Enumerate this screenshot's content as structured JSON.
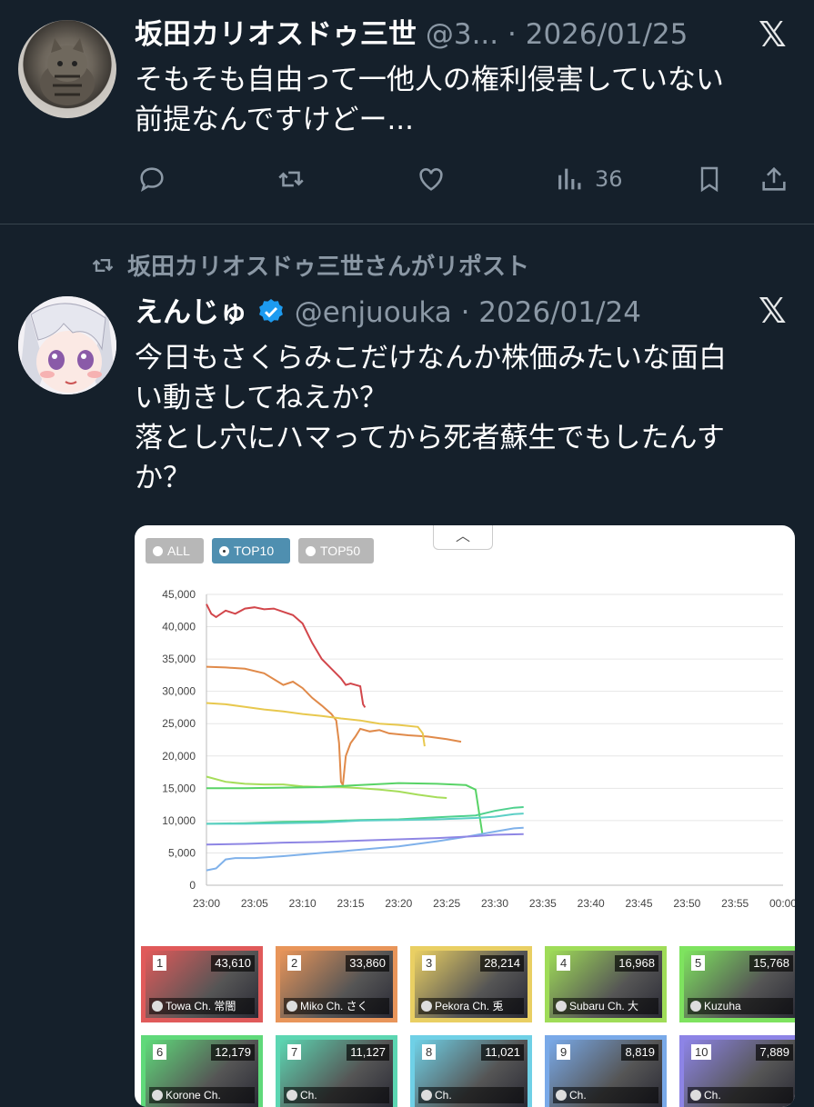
{
  "tweet1": {
    "display_name": "坂田カリオスドゥ三世",
    "handle": "@3...",
    "date": "· 2026/01/25",
    "text_lines": [
      "そもそも自由って一他人の権利侵害していない",
      "前提なんですけどー..."
    ],
    "views": "36",
    "icons": [
      "reply-icon",
      "repost-icon",
      "like-icon",
      "views-icon",
      "bookmark-icon",
      "share-icon",
      "x-logo-icon"
    ]
  },
  "tweet2": {
    "repost_label": "坂田カリオスドゥ三世さんがリポスト",
    "display_name": "えんじゅ",
    "handle": "@enjuouka",
    "date": "· 2026/01/24",
    "text_lines": [
      "今日もさくらみこだけなんか株価みたいな面白",
      "い動きしてねえか？",
      "落とし穴にハマってから死者蘇生でもしたんす",
      "か？"
    ],
    "verified_icon": "verified-badge-icon"
  },
  "embedded": {
    "tabs": [
      "ALL",
      "TOP10",
      "TOP50"
    ],
    "selected_tab": "TOP10",
    "collapse_icon": "chevron-up-icon",
    "tiles": [
      {
        "rank": "1",
        "count": "43,610",
        "channel": "Towa Ch. 常闇",
        "color": "#e05a5a"
      },
      {
        "rank": "2",
        "count": "33,860",
        "channel": "Miko Ch. さく",
        "color": "#e8955a"
      },
      {
        "rank": "3",
        "count": "28,214",
        "channel": "Pekora Ch. 兎",
        "color": "#e9cf63"
      },
      {
        "rank": "4",
        "count": "16,968",
        "channel": "Subaru Ch. 大",
        "color": "#9fdc58"
      },
      {
        "rank": "5",
        "count": "15,768",
        "channel": "Kuzuha",
        "color": "#7ee35f"
      },
      {
        "rank": "6",
        "count": "12,179",
        "channel": "Korone Ch.",
        "color": "#5fd97a"
      },
      {
        "rank": "7",
        "count": "11,127",
        "channel": "Ch.",
        "color": "#5cd6b2"
      },
      {
        "rank": "8",
        "count": "11,021",
        "channel": "Ch.",
        "color": "#6fd0e6"
      },
      {
        "rank": "9",
        "count": "8,819",
        "channel": "Ch.",
        "color": "#79a9e8"
      },
      {
        "rank": "10",
        "count": "7,889",
        "channel": "Ch.",
        "color": "#8d84e6"
      }
    ]
  },
  "chart_data": {
    "type": "line",
    "x_ticks": [
      "23:00",
      "23:05",
      "23:10",
      "23:15",
      "23:20",
      "23:25",
      "23:30",
      "23:35",
      "23:40",
      "23:45",
      "23:50",
      "23:55",
      "00:00"
    ],
    "y_ticks": [
      "0",
      "5,000",
      "10,000",
      "15,000",
      "20,000",
      "25,000",
      "30,000",
      "35,000",
      "40,000",
      "45,000"
    ],
    "ylim": [
      0,
      45000
    ],
    "xlim_minutes": [
      0,
      60
    ],
    "grid": true,
    "series": [
      {
        "color": "#d2464b",
        "points": [
          [
            0,
            43500
          ],
          [
            0.5,
            42000
          ],
          [
            1,
            41500
          ],
          [
            2,
            42500
          ],
          [
            3,
            42000
          ],
          [
            4,
            42800
          ],
          [
            5,
            43000
          ],
          [
            6,
            42700
          ],
          [
            7,
            42800
          ],
          [
            8,
            42300
          ],
          [
            9,
            41800
          ],
          [
            10,
            40500
          ],
          [
            11,
            37500
          ],
          [
            12,
            35000
          ],
          [
            13,
            33500
          ],
          [
            14,
            32000
          ],
          [
            14.5,
            31000
          ],
          [
            15,
            31200
          ],
          [
            15.5,
            31000
          ],
          [
            16,
            30800
          ],
          [
            16.3,
            28000
          ],
          [
            16.5,
            27500
          ]
        ]
      },
      {
        "color": "#e08a4a",
        "points": [
          [
            0,
            33800
          ],
          [
            2,
            33700
          ],
          [
            4,
            33500
          ],
          [
            6,
            32800
          ],
          [
            8,
            31000
          ],
          [
            9,
            31500
          ],
          [
            10,
            30500
          ],
          [
            11,
            29000
          ],
          [
            12,
            27800
          ],
          [
            13,
            26500
          ],
          [
            13.5,
            25500
          ],
          [
            13.8,
            22000
          ],
          [
            14,
            16000
          ],
          [
            14.2,
            15500
          ],
          [
            14.5,
            20000
          ],
          [
            15,
            22000
          ],
          [
            15.5,
            23000
          ],
          [
            16,
            24200
          ],
          [
            17,
            23800
          ],
          [
            18,
            24000
          ],
          [
            19,
            23500
          ],
          [
            21,
            23200
          ],
          [
            23,
            23000
          ],
          [
            25,
            22600
          ],
          [
            26.5,
            22200
          ]
        ]
      },
      {
        "color": "#e8c84e",
        "points": [
          [
            0,
            28200
          ],
          [
            2,
            28000
          ],
          [
            4,
            27600
          ],
          [
            6,
            27200
          ],
          [
            8,
            26900
          ],
          [
            10,
            26500
          ],
          [
            12,
            26200
          ],
          [
            14,
            25800
          ],
          [
            16,
            25500
          ],
          [
            18,
            25000
          ],
          [
            20,
            24800
          ],
          [
            22,
            24500
          ],
          [
            22.5,
            23500
          ],
          [
            22.7,
            21500
          ]
        ]
      },
      {
        "color": "#a6dd5a",
        "points": [
          [
            0,
            16800
          ],
          [
            2,
            16000
          ],
          [
            4,
            15700
          ],
          [
            6,
            15600
          ],
          [
            8,
            15600
          ],
          [
            10,
            15300
          ],
          [
            12,
            15200
          ],
          [
            14,
            15200
          ],
          [
            16,
            15000
          ],
          [
            18,
            14800
          ],
          [
            20,
            14500
          ],
          [
            22,
            14000
          ],
          [
            24,
            13600
          ],
          [
            25,
            13500
          ]
        ]
      },
      {
        "color": "#58d366",
        "points": [
          [
            0,
            15000
          ],
          [
            4,
            15000
          ],
          [
            8,
            15100
          ],
          [
            12,
            15200
          ],
          [
            16,
            15500
          ],
          [
            20,
            15800
          ],
          [
            24,
            15700
          ],
          [
            27,
            15500
          ],
          [
            28,
            14800
          ],
          [
            28.5,
            10000
          ],
          [
            28.7,
            8000
          ]
        ]
      },
      {
        "color": "#4fd18e",
        "points": [
          [
            0,
            9500
          ],
          [
            4,
            9600
          ],
          [
            8,
            9800
          ],
          [
            12,
            9900
          ],
          [
            16,
            10100
          ],
          [
            20,
            10200
          ],
          [
            24,
            10500
          ],
          [
            28,
            10800
          ],
          [
            30,
            11500
          ],
          [
            32,
            12000
          ],
          [
            33,
            12100
          ]
        ]
      },
      {
        "color": "#5ccfc6",
        "points": [
          [
            0,
            9500
          ],
          [
            4,
            9500
          ],
          [
            8,
            9600
          ],
          [
            12,
            9700
          ],
          [
            16,
            10000
          ],
          [
            20,
            10100
          ],
          [
            24,
            10200
          ],
          [
            28,
            10400
          ],
          [
            30,
            10600
          ],
          [
            32,
            11000
          ],
          [
            33,
            11100
          ]
        ]
      },
      {
        "color": "#7fb1ea",
        "points": [
          [
            0,
            2300
          ],
          [
            1,
            2600
          ],
          [
            2,
            4000
          ],
          [
            3,
            4200
          ],
          [
            5,
            4200
          ],
          [
            8,
            4500
          ],
          [
            12,
            5000
          ],
          [
            16,
            5500
          ],
          [
            20,
            6000
          ],
          [
            24,
            6800
          ],
          [
            27,
            7500
          ],
          [
            30,
            8300
          ],
          [
            32,
            8800
          ],
          [
            33,
            8900
          ]
        ]
      },
      {
        "color": "#8e86e4",
        "points": [
          [
            0,
            6300
          ],
          [
            4,
            6400
          ],
          [
            8,
            6600
          ],
          [
            12,
            6700
          ],
          [
            16,
            6900
          ],
          [
            20,
            7100
          ],
          [
            24,
            7300
          ],
          [
            28,
            7600
          ],
          [
            30,
            7800
          ],
          [
            33,
            7900
          ]
        ]
      }
    ]
  }
}
